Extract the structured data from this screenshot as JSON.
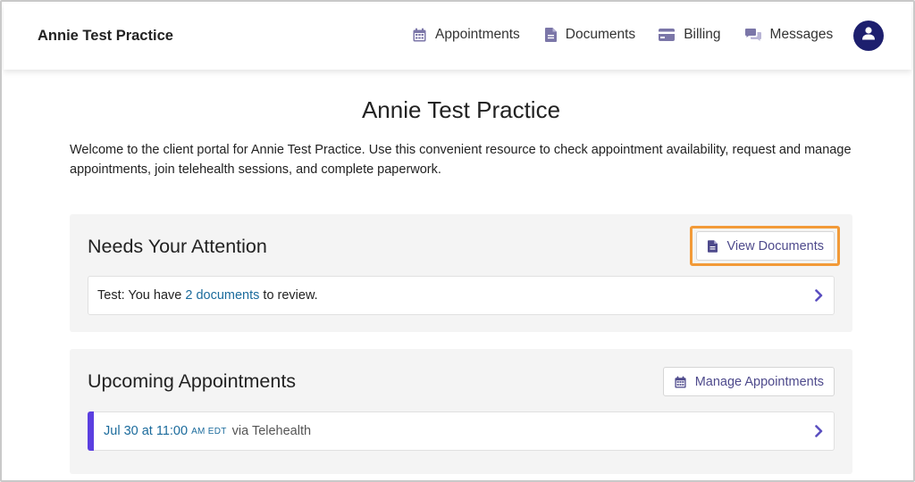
{
  "header": {
    "brand": "Annie Test Practice",
    "nav": [
      {
        "label": "Appointments",
        "icon": "calendar-icon"
      },
      {
        "label": "Documents",
        "icon": "document-icon"
      },
      {
        "label": "Billing",
        "icon": "credit-card-icon"
      },
      {
        "label": "Messages",
        "icon": "chat-bubbles-icon"
      }
    ],
    "avatar_icon": "user-icon"
  },
  "main": {
    "title": "Annie Test Practice",
    "welcome": "Welcome to the client portal for Annie Test Practice. Use this convenient resource to check appointment availability, request and manage appointments, join telehealth sessions, and complete paperwork."
  },
  "attention": {
    "title": "Needs Your Attention",
    "button_label": "View Documents",
    "row": {
      "prefix": "Test: You have ",
      "link": "2 documents",
      "suffix": " to review."
    }
  },
  "upcoming": {
    "title": "Upcoming Appointments",
    "button_label": "Manage Appointments",
    "appointment": {
      "date_time": "Jul 30 at 11:00",
      "meridiem_tz": "AM EDT",
      "via": "via Telehealth"
    }
  },
  "colors": {
    "accent": "#4e4a8c",
    "link": "#1b6b9c",
    "avatar": "#1d1f6e",
    "highlight": "#f29a38",
    "appointment_bar": "#5b3fe0",
    "icon": "#7b76a8"
  }
}
